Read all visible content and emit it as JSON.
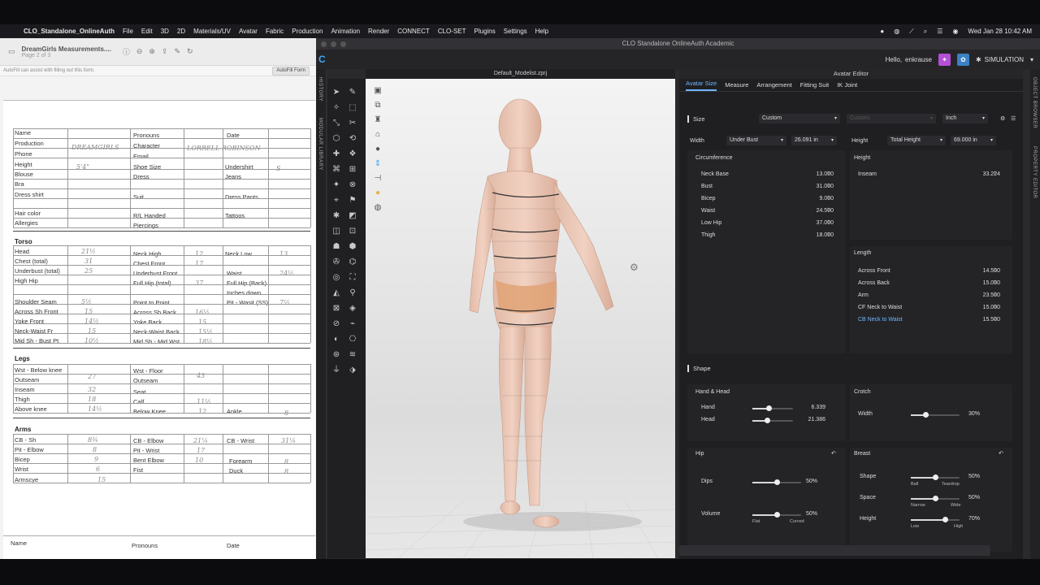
{
  "menubar": {
    "app": "CLO_Standalone_OnlineAuth",
    "items": [
      "File",
      "Edit",
      "3D",
      "2D",
      "Materials/UV",
      "Avatar",
      "Fabric",
      "Production",
      "Animation",
      "Render",
      "CONNECT",
      "CLO-SET",
      "Plugins",
      "Settings",
      "Help"
    ],
    "datetime": "Wed Jan 28  10:42 AM"
  },
  "pdf": {
    "title": "DreamGirls Measurements....",
    "subtitle": "Page 2 of 3",
    "autofill_msg": "AutoFill can assist with filling out this form.",
    "autofill_btn": "AutoFill Form",
    "labels": {
      "name": "Name",
      "pronouns": "Pronouns",
      "date": "Date",
      "production": "Production",
      "character": "Character",
      "phone": "Phone",
      "email": "Email",
      "height": "Height",
      "shoe": "Shoe Size",
      "undershirt": "Undershirt",
      "blouse": "Blouse",
      "dress": "Dress",
      "jeans": "Jeans",
      "bra": "Bra",
      "dressshirt": "Dress shirt",
      "suit": "Suit",
      "dresspants": "Dress Pants",
      "hair": "Hair color",
      "rl": "R/L Handed",
      "tattoos": "Tattoos",
      "allergies": "Allergies",
      "piercings": "Piercings",
      "torso": "Torso",
      "head": "Head",
      "neckhigh": "Neck High",
      "necklow": "Neck Low",
      "chest": "Chest (total)",
      "chestfront": "Chest Front",
      "underbust": "Underbust (total)",
      "underbustfront": "Underbust Front",
      "waist": "Waist",
      "highhip": "High Hip",
      "fullhip": "Full Hip (total)",
      "fullhipback": "Full Hip (Back)",
      "inches": "Inches down",
      "shoulderseam": "Shoulder Seam",
      "pointtopoint": "Point to Point",
      "pitwaist": "Pit - Wasit (SS)",
      "acrossfront": "Across Sh Front",
      "acrossback": "Across Sh Back",
      "yokefront": "Yoke Front",
      "yokeback": "Yoke Back",
      "neckwaistfr": "Neck-Waist Fr",
      "neckwaistback": "Neck-Waist Back",
      "midbust": "Mid Sh - Bust Pt",
      "midmid": "Mid Sh - Mid Wst",
      "legs": "Legs",
      "wstbelow": "Wst - Below knee",
      "outseam": "Outseam",
      "wstfloor": "Wst - Floor",
      "outseam2": "Outseam",
      "inseam": "Inseam",
      "seat": "Seat",
      "thigh": "Thigh",
      "calf": "Calf",
      "aboveknee": "Above knee",
      "belowknee": "Below Knee",
      "ankle": "Ankle",
      "arms": "Arms",
      "cbsh": "CB - Sh",
      "cbelbow": "CB - Elbow",
      "cbwrist": "CB - Wrist",
      "pitelbow": "Pit - Elbow",
      "pitwrist": "Pit - Wrist",
      "bicep": "Bicep",
      "bentelbow": "Bent Elbow",
      "forearm": "Forearm",
      "wrist": "Wrist",
      "fist": "Fist",
      "duck": "Duck",
      "armscye": "Armscye",
      "name2": "Name",
      "pronouns2": "Pronouns",
      "date2": "Date"
    },
    "values": {
      "production": "DREAMGIRLS",
      "character": "LORRELL  ROBINSON",
      "height": "5'4\"",
      "undershirt": "S",
      "head": "21½",
      "neckhigh": "12",
      "necklow": "13",
      "chest": "31",
      "chestfront": "17",
      "underbust": "25",
      "waist": "24½",
      "fullhip": "37",
      "shoulderseam": "5½",
      "pitwaist": "7½",
      "acrossfront": "15",
      "acrossback": "16½",
      "yokefront": "14½",
      "yokeback": "15",
      "neckwaistfr": "15",
      "neckwaistback": "15½",
      "midbust": "10½",
      "midmid": "18½",
      "outseam": "27",
      "outseam2": "43",
      "inseam": "32",
      "thigh": "18",
      "calf": "11½",
      "aboveknee": "14½",
      "belowknee": "12",
      "ankle": "8",
      "cbsh": "8¾",
      "cbelbow": "21¼",
      "cbwrist": "31¼",
      "pitelbow": "8",
      "pitwrist": "17",
      "bicep": "9",
      "bentelbow": "10",
      "forearm": "8",
      "wrist": "6",
      "duck": "8",
      "armscye": "15"
    }
  },
  "clo": {
    "window_title": "CLO Standalone OnlineAuth Academic",
    "hello": "Hello,",
    "user": "enkrause",
    "simulation": "SIMULATION",
    "side_history": "HISTORY",
    "side_library": "MODULAR LIBRARY",
    "side_object": "OBJECT BROWSER",
    "side_property": "PROPERTY EDITOR",
    "viewport_title": "Default_Modelist.zprj",
    "editor": {
      "title": "Avatar Editor",
      "tabs": [
        "Avatar Size",
        "Measure",
        "Arrangement",
        "Fitting Suit",
        "IK Joint"
      ],
      "size_label": "Size",
      "size_value": "Custom",
      "size_placeholder": "Custom",
      "unit": "Inch",
      "width_label": "Width",
      "width_type": "Under Bust",
      "width_value": "26.091 in",
      "height_label": "Height",
      "height_type": "Total Height",
      "height_value": "69.000 in",
      "circ_title": "Circumference",
      "circ": [
        {
          "l": "Neck Base",
          "v": "13.000"
        },
        {
          "l": "Bust",
          "v": "31.000"
        },
        {
          "l": "Bicep",
          "v": "9.000"
        },
        {
          "l": "Waist",
          "v": "24.500"
        },
        {
          "l": "Low Hip",
          "v": "37.000"
        },
        {
          "l": "Thigh",
          "v": "18.000"
        }
      ],
      "hgt_title": "Height",
      "hgt": [
        {
          "l": "Inseam",
          "v": "33.224"
        }
      ],
      "len_title": "Length",
      "len": [
        {
          "l": "Across Front",
          "v": "14.500"
        },
        {
          "l": "Across Back",
          "v": "15.000"
        },
        {
          "l": "Arm",
          "v": "23.500"
        },
        {
          "l": "CF Neck to Waist",
          "v": "15.000"
        },
        {
          "l": "CB Neck to Waist",
          "v": "15.500"
        }
      ],
      "shape_label": "Shape",
      "handhead_title": "Hand & Head",
      "hand_label": "Hand",
      "hand_value": "6.339",
      "head_label": "Head",
      "head_value": "21.386",
      "hand_level": 0.4,
      "head_level": 0.35,
      "crotch_title": "Crotch",
      "crotch_width_label": "Width",
      "crotch_width_value": "30%",
      "crotch_level": 0.3,
      "hip_title": "Hip",
      "dips_label": "Dips",
      "dips_value": "50%",
      "volume_label": "Volume",
      "volume_value": "50%",
      "flat": "Flat",
      "curved": "Curved",
      "dips_level": 0.5,
      "volume_level": 0.5,
      "breast_title": "Breast",
      "bshape_label": "Shape",
      "bshape_value": "50%",
      "ball": "Ball",
      "teardrop": "Teardrop",
      "space_label": "Space",
      "space_value": "50%",
      "narrow": "Narrow",
      "wide": "Wide",
      "bheight_label": "Height",
      "bheight_value": "70%",
      "low": "Low",
      "high": "High",
      "bshape_level": 0.5,
      "space_level": 0.5,
      "bheight_level": 0.7
    }
  }
}
